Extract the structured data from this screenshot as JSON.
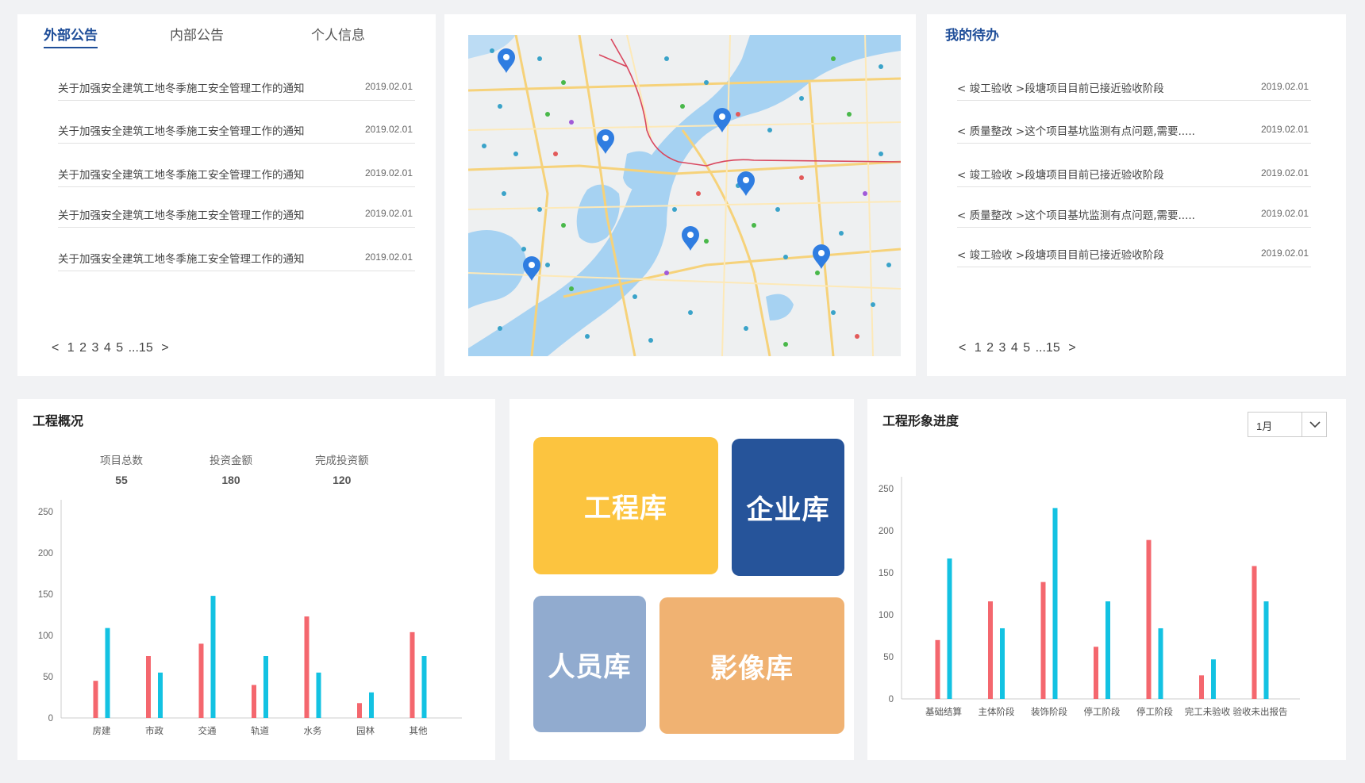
{
  "notices": {
    "tabs": [
      {
        "label": "外部公告",
        "active": true
      },
      {
        "label": "内部公告",
        "active": false
      },
      {
        "label": "个人信息",
        "active": false
      }
    ],
    "items": [
      {
        "title": "关于加强安全建筑工地冬季施工安全管理工作的通知",
        "date": "2019.02.01"
      },
      {
        "title": "关于加强安全建筑工地冬季施工安全管理工作的通知",
        "date": "2019.02.01"
      },
      {
        "title": "关于加强安全建筑工地冬季施工安全管理工作的通知",
        "date": "2019.02.01"
      },
      {
        "title": "关于加强安全建筑工地冬季施工安全管理工作的通知",
        "date": "2019.02.01"
      },
      {
        "title": "关于加强安全建筑工地冬季施工安全管理工作的通知",
        "date": "2019.02.01"
      }
    ],
    "pager": {
      "prev": "<",
      "pages": [
        "1",
        "2",
        "3",
        "4",
        "5"
      ],
      "ellipsis_last": "...15",
      "next": ">"
    }
  },
  "map": {
    "marker_icon": "map-pin-icon",
    "marker_color": "#2f7de1",
    "water_color": "#a6d2f2",
    "land_color": "#eef0f1",
    "road_color": "#f6d27a",
    "rail_color": "#d9475e"
  },
  "todo": {
    "title": "我的待办",
    "items": [
      {
        "title": "< 竣工验收 >段塘项目目前已接近验收阶段",
        "date": "2019.02.01"
      },
      {
        "title": "< 质量整改 >这个项目基坑监测有点问题,需要.....",
        "date": "2019.02.01"
      },
      {
        "title": "< 竣工验收 >段塘项目目前已接近验收阶段",
        "date": "2019.02.01"
      },
      {
        "title": "< 质量整改 >这个项目基坑监测有点问题,需要.....",
        "date": "2019.02.01"
      },
      {
        "title": "< 竣工验收 >段塘项目目前已接近验收阶段",
        "date": "2019.02.01"
      }
    ],
    "pager": {
      "prev": "<",
      "pages": [
        "1",
        "2",
        "3",
        "4",
        "5"
      ],
      "ellipsis_last": "...15",
      "next": ">"
    }
  },
  "overview": {
    "title": "工程概况",
    "stats": [
      {
        "label": "项目总数",
        "value": "55"
      },
      {
        "label": "投资金额",
        "value": "180"
      },
      {
        "label": "完成投资额",
        "value": "120"
      }
    ]
  },
  "libraries": {
    "tiles": [
      {
        "label": "工程库",
        "color": "#fcc43f"
      },
      {
        "label": "企业库",
        "color": "#26549a"
      },
      {
        "label": "人员库",
        "color": "#91abcf"
      },
      {
        "label": "影像库",
        "color": "#f0b272"
      }
    ]
  },
  "progress": {
    "title": "工程形象进度",
    "month_select": {
      "value": "1月",
      "icon": "chevron-down-icon"
    }
  },
  "chart_data": [
    {
      "type": "bar",
      "title": "工程概况",
      "categories": [
        "房建",
        "市政",
        "交通",
        "轨道",
        "水务",
        "园林",
        "其他"
      ],
      "ylim": [
        0,
        250
      ],
      "yticks": [
        0,
        50,
        100,
        150,
        200,
        250
      ],
      "grid": false,
      "series": [
        {
          "color": "#f4676e",
          "values": [
            45,
            75,
            90,
            40,
            123,
            18,
            104
          ]
        },
        {
          "color": "#13c2e2",
          "values": [
            109,
            55,
            148,
            75,
            55,
            31,
            75
          ]
        }
      ]
    },
    {
      "type": "bar",
      "title": "工程形象进度",
      "categories": [
        "基础结算",
        "主体阶段",
        "装饰阶段",
        "停工阶段",
        "停工阶段",
        "完工未验收",
        "验收未出报告"
      ],
      "ylim": [
        0,
        250
      ],
      "yticks": [
        0,
        50,
        100,
        150,
        200,
        250
      ],
      "grid": false,
      "series": [
        {
          "color": "#f4676e",
          "values": [
            70,
            116,
            139,
            62,
            189,
            28,
            158
          ]
        },
        {
          "color": "#13c2e2",
          "values": [
            167,
            84,
            227,
            116,
            84,
            47,
            116
          ]
        }
      ]
    }
  ]
}
